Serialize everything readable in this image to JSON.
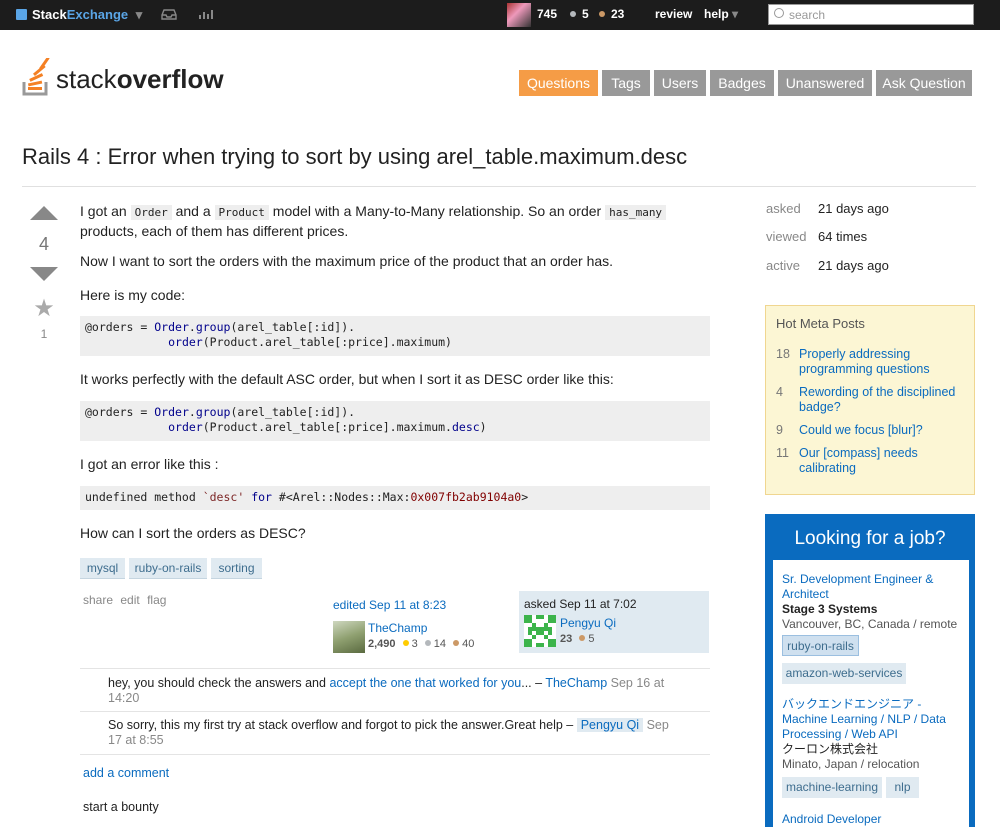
{
  "topbar": {
    "brand_a": "Stack",
    "brand_b": "Exchange",
    "brand_caret": "▾",
    "rep": "745",
    "silver": "5",
    "bronze": "23",
    "review": "review",
    "help": "help",
    "help_caret": "▾",
    "search_placeholder": "search",
    "colors": {
      "bg": "#1c1c1c",
      "silver": "#b4b8bc",
      "bronze": "#cc9966"
    }
  },
  "site": {
    "logo_a": "stack",
    "logo_b": "overflow"
  },
  "nav": {
    "items": [
      {
        "label": "Questions",
        "active": true
      },
      {
        "label": "Tags"
      },
      {
        "label": "Users"
      },
      {
        "label": "Badges"
      },
      {
        "label": "Unanswered"
      },
      {
        "label": "Ask Question"
      }
    ],
    "colors": {
      "active": "#f59c46",
      "inactive": "#999999"
    }
  },
  "question": {
    "title": "Rails 4 : Error when trying to sort by using arel_table.maximum.desc",
    "votes": "4",
    "favorites": "1",
    "p1": {
      "a": "I got an ",
      "c1": "Order",
      "b": " and a ",
      "c2": "Product",
      "c": " model with a Many-to-Many relationship. So an order ",
      "c3": "has_many",
      "d": "products, each of them has different prices."
    },
    "p2": "Now I want to sort the orders with the maximum price of the product that an order has.",
    "p3": "Here is my code:",
    "code1": {
      "l1a": "@orders = ",
      "l1b": "Order",
      "l1c": ".",
      "l1d": "group",
      "l1e": "(arel_table[:id]).",
      "l2a": "            ",
      "l2b": "order",
      "l2c": "(Product.arel_table[:price].maximum)"
    },
    "p4": "It works perfectly with the default ASC order, but when I sort it as DESC order like this:",
    "code2": {
      "l1a": "@orders = ",
      "l1b": "Order",
      "l1c": ".",
      "l1d": "group",
      "l1e": "(arel_table[:id]).",
      "l2a": "            ",
      "l2b": "order",
      "l2c": "(Product.arel_table[:price].maximum.",
      "l2d": "desc",
      "l2e": ")"
    },
    "p5": "I got an error like this :",
    "code3": {
      "a": "undefined method ",
      "b": "`desc'",
      "c": " ",
      "d": "for",
      "e": " #<Arel::Nodes::Max:",
      "f": "0x007fb2ab9104a0",
      "g": ">"
    },
    "p6": "How can I sort the orders as DESC?",
    "tags": [
      "mysql",
      "ruby-on-rails",
      "sorting"
    ],
    "menu": [
      "share",
      "edit",
      "flag"
    ],
    "edited": {
      "action": "edited Sep 11 at 8:23",
      "user": "TheChamp",
      "rep": "2,490",
      "gold": "3",
      "silver": "14",
      "bronze": "40"
    },
    "asked": {
      "action": "asked Sep 11 at 7:02",
      "user": "Pengyu Qi",
      "rep": "23",
      "bronze": "5"
    }
  },
  "comments": [
    {
      "text": "hey, you should check the answers and ",
      "link": "accept the one that worked for you",
      "after": "... – ",
      "user": "TheChamp",
      "date": " Sep 16 at 14:20"
    },
    {
      "text": "So sorry, this my first try at stack overflow and forgot to pick the answer.Great help – ",
      "user": "Pengyu Qi",
      "date": " Sep 17 at 8:55"
    }
  ],
  "add_comment": "add a comment",
  "start_bounty": "start a bounty",
  "stats": [
    {
      "label": "asked",
      "value": "21 days ago"
    },
    {
      "label": "viewed",
      "value": "64 times"
    },
    {
      "label": "active",
      "value": "21 days ago"
    }
  ],
  "hot_meta": {
    "title": "Hot Meta Posts",
    "items": [
      {
        "n": "18",
        "t": "Properly addressing programming questions"
      },
      {
        "n": "4",
        "t": "Rewording of the disciplined badge?"
      },
      {
        "n": "9",
        "t": "Could we focus [blur]?"
      },
      {
        "n": "11",
        "t": "Our [compass] needs calibrating"
      }
    ]
  },
  "jobs": {
    "title": "Looking for a job?",
    "list": [
      {
        "title": "Sr. Development Engineer & Architect",
        "company": "Stage 3 Systems",
        "location": "Vancouver, BC, Canada / remote",
        "tags": [
          "ruby-on-rails",
          "amazon-web-services"
        ]
      },
      {
        "title": "バックエンドエンジニア - Machine Learning / NLP / Data Processing / Web API",
        "company": "クーロン株式会社",
        "location": "Minato, Japan / relocation",
        "tags": [
          "machine-learning",
          "nlp"
        ]
      },
      {
        "title": "Android Developer"
      }
    ]
  }
}
